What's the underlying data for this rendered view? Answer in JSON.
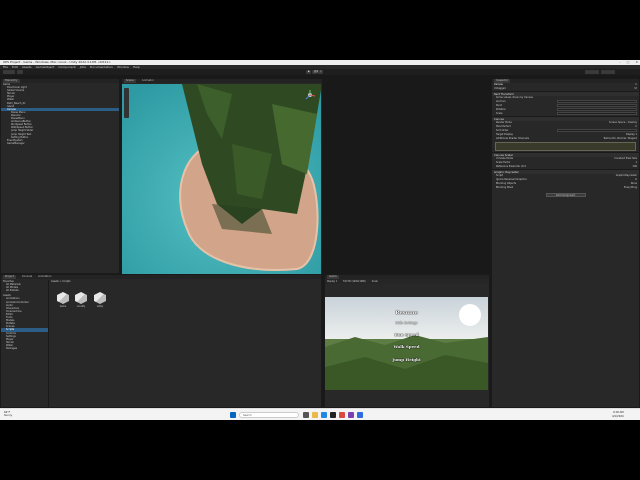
{
  "window": {
    "title": "OPS Project - Game - Windows, Mac, Linux - Unity 2022.3.10f1 <DX11>"
  },
  "menu": [
    "File",
    "Edit",
    "Assets",
    "GameObject",
    "Component",
    "Jobs",
    "Documentation",
    "Window",
    "Help"
  ],
  "hierarchy": {
    "tab": "Hierarchy",
    "items": [
      "Game",
      "Directional Light",
      "Global Volume",
      "Terrain",
      "Player",
      "Water",
      "Palm_Beach_01",
      "Island",
      "Canvas",
      "Pause Menu",
      "Resume",
      "PauseMenu",
      "AmbienceButton",
      "RunSpeed Button",
      "WalkSpeed Button",
      "Jump Height Slider",
      "Jump Height Text",
      "Setting Button",
      "EventSystem",
      "GameManager"
    ],
    "selected_index": 8
  },
  "scene": {
    "tabs": [
      "Scene",
      "Animator"
    ],
    "active": "Scene"
  },
  "game": {
    "tab": "Game",
    "toolbar_display": "Display 1",
    "toolbar_res": "Full HD (1920x1080)",
    "toolbar_scale": "Scale",
    "menu_buttons": [
      "Resume",
      "Run Speed",
      "Walk Speed",
      "Jump Height"
    ],
    "hidden_button": "Hide Settings"
  },
  "project": {
    "tabs": [
      "Project",
      "Console",
      "Animation"
    ],
    "breadcrumb": "Assets > Scripts",
    "favorites": [
      "Favorites",
      "All Materials",
      "All Models",
      "All Prefabs"
    ],
    "folders": [
      "Assets",
      "Animations",
      "AnimatorController",
      "Audio",
      "Characters",
      "Cinemachine",
      "Editor",
      "Fonts",
      "Models",
      "Prefabs",
      "Scenes",
      "Scripts",
      "Controls",
      "Settings",
      "Player",
      "Terrain",
      "Water",
      "Packages"
    ],
    "files": [
      "Game",
      "Locality",
      "Lobby"
    ]
  },
  "inspector": {
    "tab": "Inspector",
    "object_name": "Canvas",
    "tag": "Untagged",
    "layer": "UI",
    "components": [
      {
        "name": "Rect Transform",
        "rows": [
          "Some values driven by Canvas",
          "Anchors",
          "Pivot",
          "Rotation",
          "Scale"
        ]
      },
      {
        "name": "Canvas",
        "rows": [
          "Render Mode",
          "Pixel Perfect",
          "Sort Order",
          "Target Display",
          "Additional Shader Channels"
        ]
      },
      {
        "name": "Canvas Scaler",
        "rows": [
          "UI Scale Mode",
          "Scale Factor",
          "Reference Pixels Per Unit"
        ]
      },
      {
        "name": "Graphic Raycaster",
        "rows": [
          "Script",
          "Ignore Reversed Graphics",
          "Blocking Objects",
          "Blocking Mask"
        ]
      }
    ],
    "values": {
      "render_mode": "Screen Space - Overlay",
      "target_display": "Display 1",
      "shader_channels": "TexCoord1, Normal, Tangent",
      "scale_mode": "Constant Pixel Size",
      "scale_factor": "1",
      "ppu": "100",
      "script": "GraphicRaycaster",
      "blocking_objects": "None",
      "blocking_mask": "Everything"
    },
    "add_component": "Add Component"
  },
  "taskbar": {
    "weather": "64°F",
    "weather_sub": "Sunny",
    "search": "Search",
    "time": "9:18 AM",
    "date": "4/1/2024"
  }
}
